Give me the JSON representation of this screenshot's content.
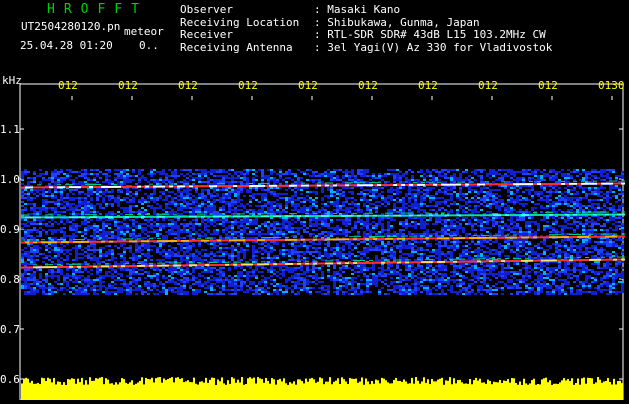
{
  "header": {
    "logo": "HROFFT",
    "filename": "UT2504280120.pn",
    "mode_tag": "meteor",
    "datetime": "25.04.28 01:20",
    "extra": "0..",
    "info_rows": [
      {
        "label": "Observer",
        "value": "Masaki Kano"
      },
      {
        "label": "Receiving Location",
        "value": "Shibukawa, Gunma, Japan"
      },
      {
        "label": "Receiver",
        "value": "RTL-SDR SDR# 43dB L15 103.2MHz CW"
      },
      {
        "label": "Receiving Antenna",
        "value": "3el Yagi(V) Az 330 for Vladivostok"
      }
    ]
  },
  "plot": {
    "y_unit": "kHz",
    "y_ticks": [
      "1.1",
      "1.0",
      "0.9",
      "0.8",
      "0.7",
      "0.6"
    ],
    "time_labels": [
      "012",
      "012",
      "012",
      "012",
      "012",
      "012",
      "012",
      "012",
      "012",
      "0130"
    ],
    "colors": {
      "background": "#000000",
      "noise": "#1a2cff",
      "strong": "#ff3030",
      "medium": "#00e0a0",
      "floor": "#ffff00"
    }
  }
}
